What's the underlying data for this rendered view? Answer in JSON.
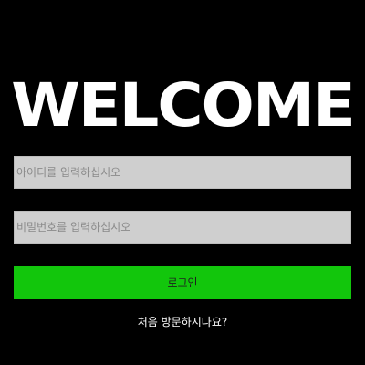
{
  "title": "WELCOME",
  "form": {
    "id_placeholder": "아이디를 입력하십시오",
    "password_placeholder": "비밀번호를 입력하십시오",
    "id_value": "",
    "password_value": "",
    "login_label": "로그인"
  },
  "signup_prompt": "처음 방문하시나요?",
  "colors": {
    "background": "#000000",
    "title": "#ffffff",
    "input_bg": "#cfcfcf",
    "button_bg": "#12c60c"
  }
}
